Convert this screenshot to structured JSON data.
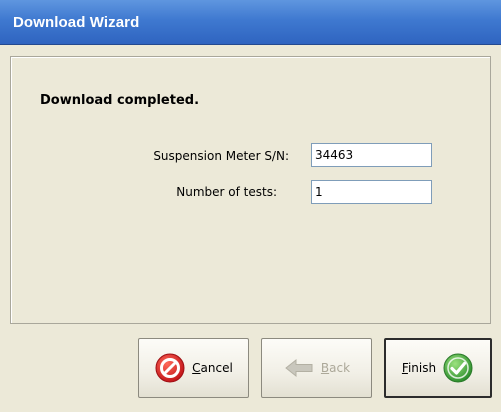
{
  "window": {
    "title": "Download Wizard"
  },
  "content": {
    "heading": "Download completed.",
    "fields": {
      "serial_label": "Suspension Meter S/N:",
      "serial_value": "34463",
      "tests_label": "Number of tests:",
      "tests_value": "1"
    }
  },
  "buttons": {
    "cancel_first": "C",
    "cancel_rest": "ancel",
    "back_first": "B",
    "back_rest": "ack",
    "finish_first": "F",
    "finish_rest": "inish"
  },
  "icons": {
    "cancel": "cancel-icon",
    "back": "back-arrow-icon",
    "finish": "check-icon"
  },
  "colors": {
    "titlebar": "#3f79d0",
    "background": "#ece9d8",
    "cancel_red": "#d52222",
    "finish_green": "#3aa43a",
    "disabled_text": "#aca899"
  }
}
